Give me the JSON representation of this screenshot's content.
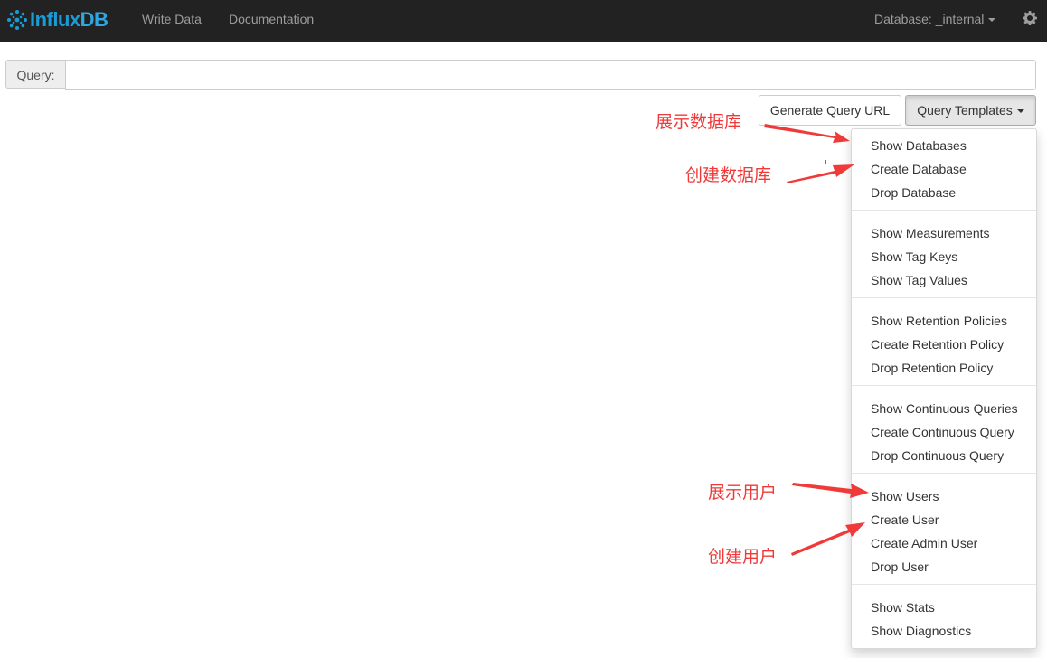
{
  "navbar": {
    "brand_main": "Influx",
    "brand_suffix": "DB",
    "links": [
      "Write Data",
      "Documentation"
    ],
    "database_label": "Database: _internal",
    "settings_icon": "gear-icon"
  },
  "query": {
    "addon_label": "Query:",
    "value": "",
    "placeholder": ""
  },
  "buttons": {
    "generate_url": "Generate Query URL",
    "templates": "Query Templates"
  },
  "menu": {
    "groups": [
      [
        "Show Databases",
        "Create Database",
        "Drop Database"
      ],
      [
        "Show Measurements",
        "Show Tag Keys",
        "Show Tag Values"
      ],
      [
        "Show Retention Policies",
        "Create Retention Policy",
        "Drop Retention Policy"
      ],
      [
        "Show Continuous Queries",
        "Create Continuous Query",
        "Drop Continuous Query"
      ],
      [
        "Show Users",
        "Create User",
        "Create Admin User",
        "Drop User"
      ],
      [
        "Show Stats",
        "Show Diagnostics"
      ]
    ]
  },
  "annotations": {
    "show_databases": "展示数据库",
    "create_database": "创建数据库",
    "show_users": "展示用户",
    "create_users": "创建用户",
    "color": "#f03a3a"
  },
  "colors": {
    "navbar_bg": "#222222",
    "brand": "#1b9bd6",
    "nav_text": "#9d9d9d"
  }
}
